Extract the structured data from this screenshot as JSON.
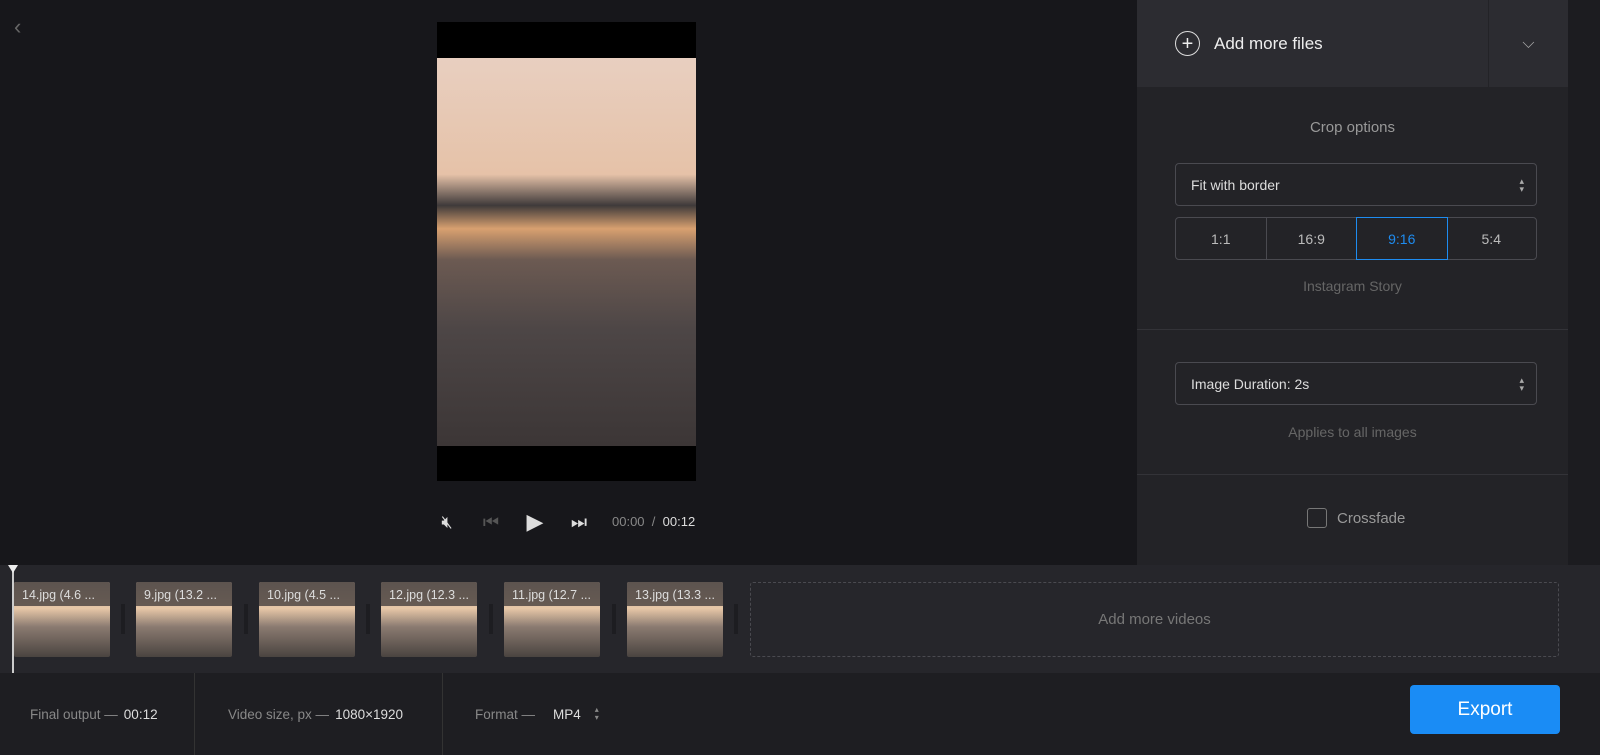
{
  "player": {
    "current_time": "00:00",
    "separator": "/",
    "total_time": "00:12"
  },
  "panel": {
    "add_files": "Add more files",
    "crop_title": "Crop options",
    "crop_mode": "Fit with border",
    "ratios": [
      "1:1",
      "16:9",
      "9:16",
      "5:4"
    ],
    "active_ratio": "9:16",
    "ratio_hint": "Instagram Story",
    "image_duration": "Image Duration: 2s",
    "duration_hint": "Applies to all images",
    "crossfade_label": "Crossfade",
    "crossfade_checked": false
  },
  "timeline": {
    "clips": [
      "14.jpg (4.6 ...",
      "9.jpg (13.2 ...",
      "10.jpg (4.5 ...",
      "12.jpg (12.3 ...",
      "11.jpg (12.7 ...",
      "13.jpg (13.3 ..."
    ],
    "add_videos": "Add more videos"
  },
  "footer": {
    "final_output_label": "Final output —",
    "final_output_value": "00:12",
    "video_size_label": "Video size, px —",
    "video_size_value": "1080×1920",
    "format_label": "Format —",
    "format_value": "MP4",
    "export": "Export"
  },
  "colors": {
    "accent": "#1a8cf5"
  }
}
